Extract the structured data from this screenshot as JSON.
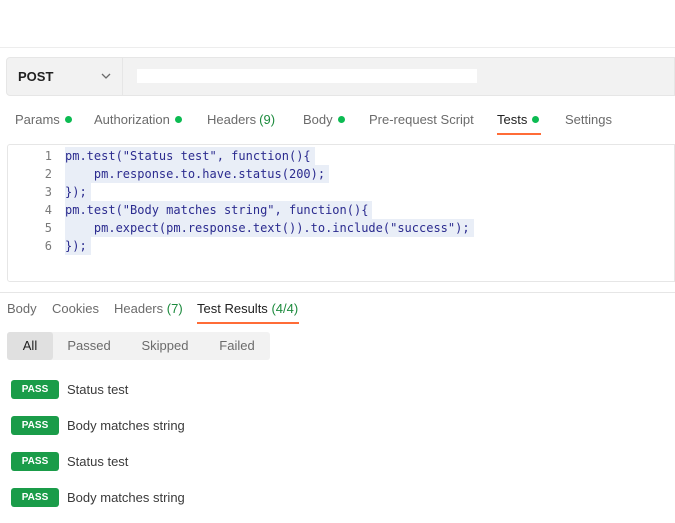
{
  "request": {
    "method": "POST",
    "tabs": [
      {
        "label": "Params",
        "count": "",
        "dot": true
      },
      {
        "label": "Authorization",
        "count": "",
        "dot": true
      },
      {
        "label": "Headers",
        "count": "(9)",
        "dot": false
      },
      {
        "label": "Body",
        "count": "",
        "dot": true
      },
      {
        "label": "Pre-request Script",
        "count": "",
        "dot": false
      },
      {
        "label": "Tests",
        "count": "",
        "dot": true
      },
      {
        "label": "Settings",
        "count": "",
        "dot": false
      }
    ],
    "active_tab": "Tests"
  },
  "editor": {
    "lines": [
      {
        "n": "1",
        "text": "pm.test(\"Status test\", function(){"
      },
      {
        "n": "2",
        "text": "    pm.response.to.have.status(200);"
      },
      {
        "n": "3",
        "text": "});"
      },
      {
        "n": "4",
        "text": "pm.test(\"Body matches string\", function(){"
      },
      {
        "n": "5",
        "text": "    pm.expect(pm.response.text()).to.include(\"success\");"
      },
      {
        "n": "6",
        "text": "});"
      }
    ]
  },
  "response": {
    "tabs": [
      {
        "label": "Body",
        "count": ""
      },
      {
        "label": "Cookies",
        "count": ""
      },
      {
        "label": "Headers",
        "count": "(7)"
      },
      {
        "label": "Test Results",
        "count": "(4/4)"
      }
    ],
    "active_tab": "Test Results",
    "filters": [
      "All",
      "Passed",
      "Skipped",
      "Failed"
    ],
    "active_filter": "All",
    "results": [
      {
        "status": "PASS",
        "name": "Status test"
      },
      {
        "status": "PASS",
        "name": "Body matches string"
      },
      {
        "status": "PASS",
        "name": "Status test"
      },
      {
        "status": "PASS",
        "name": "Body matches string"
      }
    ]
  },
  "colors": {
    "accent": "#ff6c37",
    "pass": "#1a9c49",
    "dot": "#0cbb52",
    "count": "#1c8a3d"
  },
  "icons": {
    "method_dropdown": "chevron-down-icon",
    "status_dot": "green-dot-icon"
  }
}
